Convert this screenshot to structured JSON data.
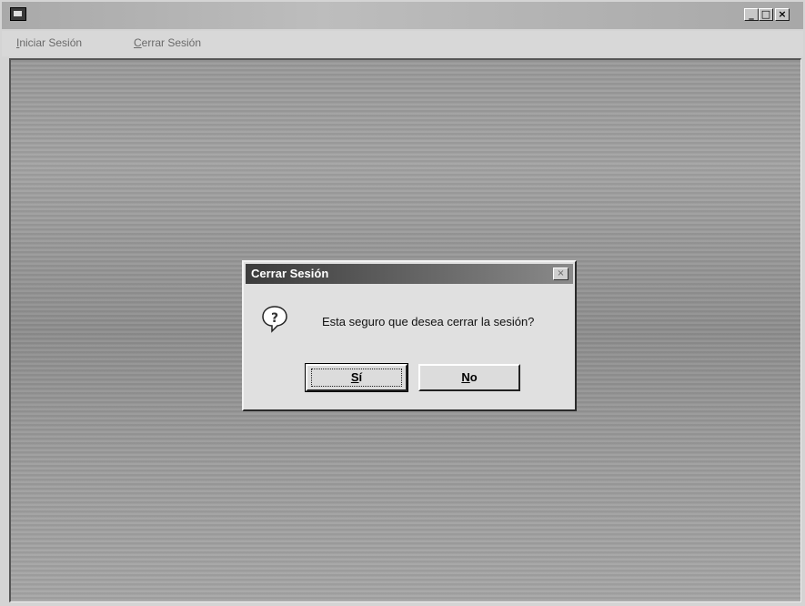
{
  "window": {
    "title": "",
    "controls": {
      "minimize": "_",
      "maximize": "□",
      "close": "×"
    }
  },
  "menubar": {
    "items": [
      {
        "label": "Iniciar Sesión",
        "mnemonic": "I",
        "rest": "niciar Sesión"
      },
      {
        "label": "Cerrar Sesión",
        "mnemonic": "C",
        "rest": "errar Sesión"
      }
    ]
  },
  "dialog": {
    "title": "Cerrar Sesión",
    "close_glyph": "×",
    "icon": "question-icon",
    "message": "Esta seguro que desea cerrar la sesión?",
    "buttons": {
      "yes": {
        "label": "Sí",
        "mnemonic": "S",
        "rest": "í"
      },
      "no": {
        "label": "No",
        "mnemonic": "N",
        "rest": "o"
      }
    }
  },
  "colors": {
    "desktop_gray": "#9a9a9a",
    "dialog_title_dark": "#3c3c3c"
  }
}
